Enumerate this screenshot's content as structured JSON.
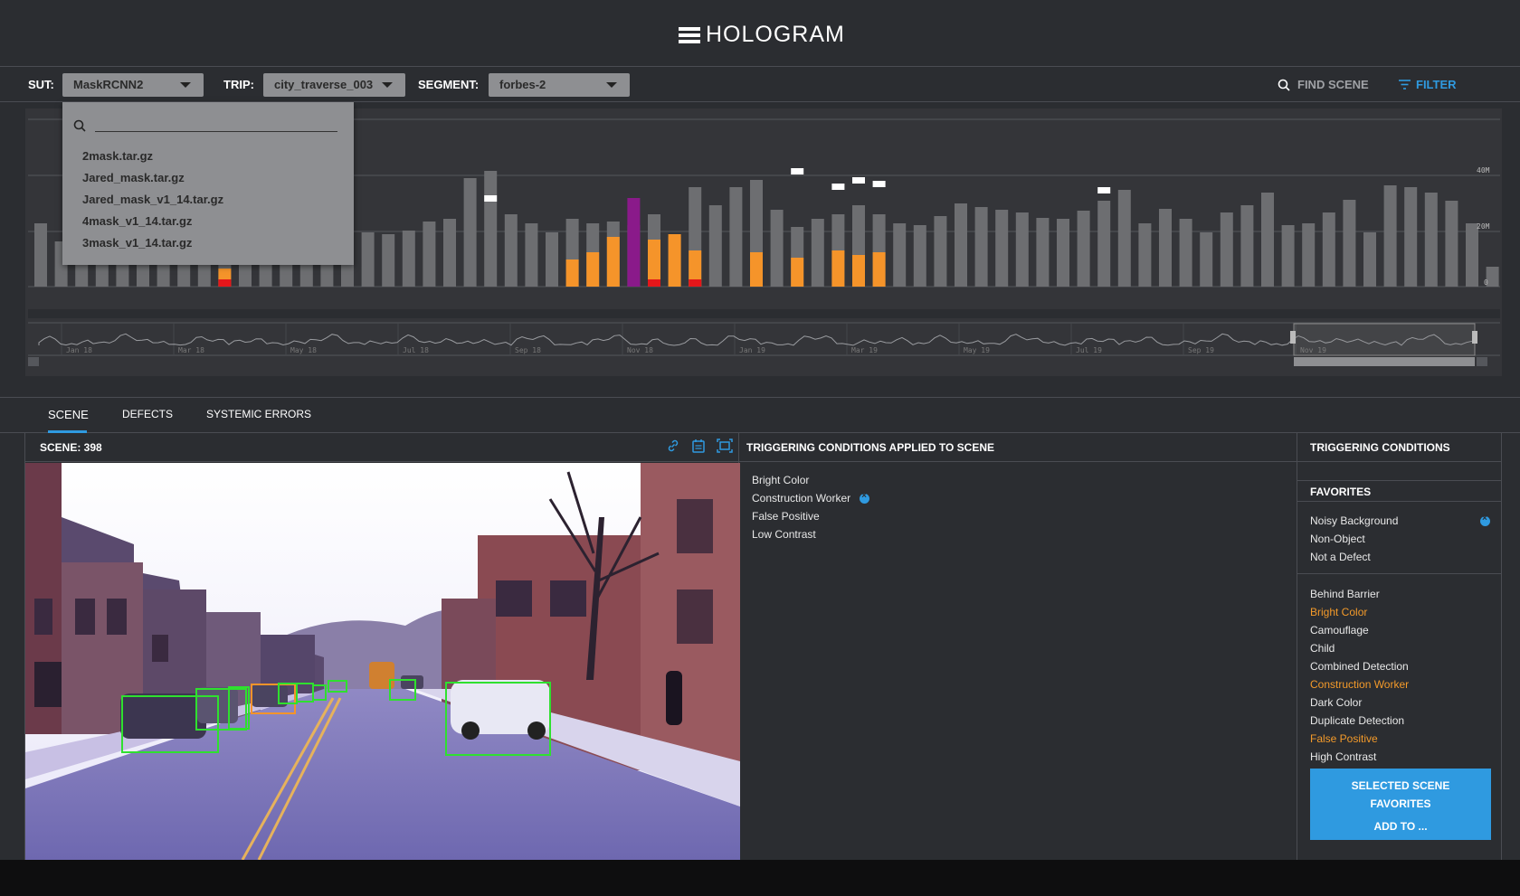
{
  "app": {
    "logo_text": "HOLOGRAM"
  },
  "toolbar": {
    "sut_label": "SUT:",
    "sut_value": "MaskRCNN2",
    "trip_label": "TRIP:",
    "trip_value": "city_traverse_003",
    "segment_label": "SEGMENT:",
    "segment_value": "forbes-2",
    "find_scene_label": "FIND SCENE",
    "filter_label": "FILTER"
  },
  "dropdown": {
    "items": [
      "2mask.tar.gz",
      "Jared_mask.tar.gz",
      "Jared_mask_v1_14.tar.gz",
      "4mask_v1_14.tar.gz",
      "3mask_v1_14.tar.gz"
    ]
  },
  "chart": {
    "y_ticks": [
      "40M",
      "20M",
      "0"
    ],
    "timeline_labels": [
      "Jan 18",
      "Mar 18",
      "May 18",
      "Jul 18",
      "Sep 18",
      "Nov 18",
      "Jan 19",
      "Mar 19",
      "May 19",
      "Jul 19",
      "Sep 19",
      "Nov 19"
    ],
    "colors": {
      "gray": "#6d6e71",
      "orange": "#f5942a",
      "red": "#e5161a",
      "purple": "#8a1a8a",
      "white": "#ffffff"
    }
  },
  "tabs": [
    {
      "label": "SCENE"
    },
    {
      "label": "DEFECTS"
    },
    {
      "label": "SYSTEMIC ERRORS"
    }
  ],
  "scene": {
    "title": "SCENE: 398",
    "icons": [
      "link-icon",
      "calendar-icon",
      "fullscreen-icon"
    ]
  },
  "applied": {
    "title": "TRIGGERING CONDITIONS APPLIED TO SCENE",
    "items": [
      "Bright Color",
      "Construction Worker",
      "False Positive",
      "Low Contrast"
    ]
  },
  "conditions": {
    "title": "TRIGGERING CONDITIONS",
    "favorites_title": "FAVORITES",
    "favorites": [
      "Noisy Background",
      "Non-Object",
      "Not a Defect"
    ],
    "items": [
      {
        "label": "Behind Barrier",
        "highlighted": false
      },
      {
        "label": "Bright Color",
        "highlighted": true
      },
      {
        "label": "Camouflage",
        "highlighted": false
      },
      {
        "label": "Child",
        "highlighted": false
      },
      {
        "label": "Combined Detection",
        "highlighted": false
      },
      {
        "label": "Construction Worker",
        "highlighted": true
      },
      {
        "label": "Dark Color",
        "highlighted": false
      },
      {
        "label": "Duplicate Detection",
        "highlighted": false
      },
      {
        "label": "False Positive",
        "highlighted": true
      },
      {
        "label": "High Contrast",
        "highlighted": false
      }
    ],
    "button_line1": "SELECTED SCENE",
    "button_line2": "FAVORITES",
    "button_line3": "ADD TO ..."
  }
}
